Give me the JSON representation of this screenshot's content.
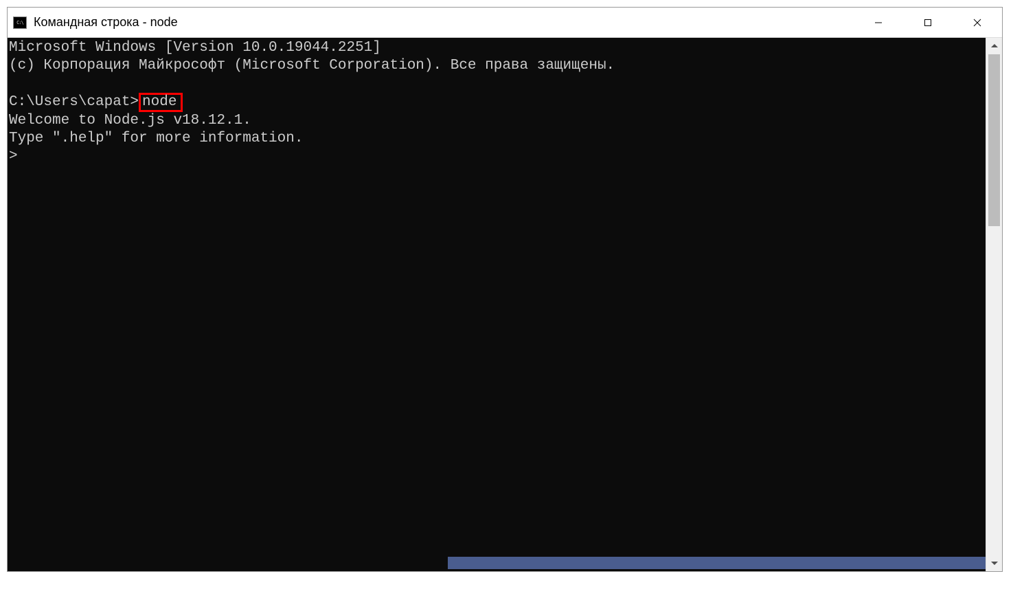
{
  "window": {
    "title": "Командная строка - node"
  },
  "terminal": {
    "line1": "Microsoft Windows [Version 10.0.19044.2251]",
    "line2": "(c) Корпорация Майкрософт (Microsoft Corporation). Все права защищены.",
    "blank1": "",
    "prompt_prefix": "C:\\Users\\capat>",
    "highlighted_command": "node",
    "welcome": "Welcome to Node.js v18.12.1.",
    "help": "Type \".help\" for more information.",
    "repl_prompt": "> "
  }
}
